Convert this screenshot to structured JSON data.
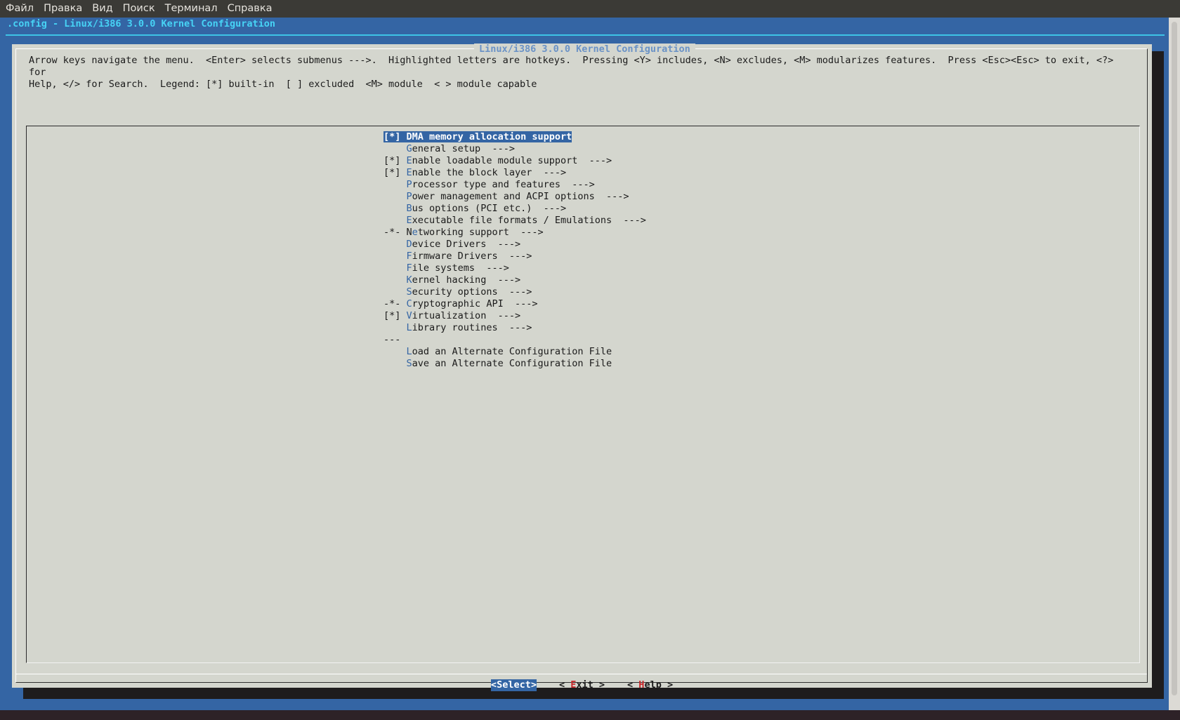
{
  "menubar": {
    "items": [
      "Файл",
      "Правка",
      "Вид",
      "Поиск",
      "Терминал",
      "Справка"
    ]
  },
  "terminal": {
    "title": ".config - Linux/i386 3.0.0 Kernel Configuration"
  },
  "dialog": {
    "title": "Linux/i386 3.0.0 Kernel Configuration",
    "help_text": "Arrow keys navigate the menu.  <Enter> selects submenus --->.  Highlighted letters are hotkeys.  Pressing <Y> includes, <N> excludes, <M> modularizes features.  Press <Esc><Esc> to exit, <?> for\nHelp, </> for Search.  Legend: [*] built-in  [ ] excluded  <M> module  < > module capable"
  },
  "menu": {
    "items": [
      {
        "prefix": "[*] ",
        "hotkey": "D",
        "rest": "MA memory allocation support",
        "selected": true
      },
      {
        "prefix": "    ",
        "hotkey": "G",
        "rest": "eneral setup  --->"
      },
      {
        "prefix": "[*] ",
        "hotkey": "E",
        "rest": "nable loadable module support  --->"
      },
      {
        "prefix": "[*] ",
        "hotkey": "E",
        "rest": "nable the block layer  --->"
      },
      {
        "prefix": "    ",
        "hotkey": "P",
        "rest": "rocessor type and features  --->"
      },
      {
        "prefix": "    ",
        "hotkey": "P",
        "rest": "ower management and ACPI options  --->"
      },
      {
        "prefix": "    ",
        "hotkey": "B",
        "rest": "us options (PCI etc.)  --->"
      },
      {
        "prefix": "    ",
        "hotkey": "E",
        "rest": "xecutable file formats / Emulations  --->"
      },
      {
        "prefix": "-*- N",
        "hotkey": "e",
        "rest": "tworking support  --->"
      },
      {
        "prefix": "    ",
        "hotkey": "D",
        "rest": "evice Drivers  --->"
      },
      {
        "prefix": "    ",
        "hotkey": "F",
        "rest": "irmware Drivers  --->"
      },
      {
        "prefix": "    ",
        "hotkey": "F",
        "rest": "ile systems  --->"
      },
      {
        "prefix": "    ",
        "hotkey": "K",
        "rest": "ernel hacking  --->"
      },
      {
        "prefix": "    ",
        "hotkey": "S",
        "rest": "ecurity options  --->"
      },
      {
        "prefix": "-*- ",
        "hotkey": "C",
        "rest": "ryptographic API  --->"
      },
      {
        "prefix": "[*] ",
        "hotkey": "V",
        "rest": "irtualization  --->"
      },
      {
        "prefix": "    ",
        "hotkey": "L",
        "rest": "ibrary routines  --->"
      },
      {
        "prefix": "---",
        "hotkey": "",
        "rest": ""
      },
      {
        "prefix": "    ",
        "hotkey": "L",
        "rest": "oad an Alternate Configuration File"
      },
      {
        "prefix": "    ",
        "hotkey": "S",
        "rest": "ave an Alternate Configuration File"
      }
    ]
  },
  "buttons": {
    "select": {
      "open": "<",
      "hotkey": "S",
      "rest": "elect>"
    },
    "exit": {
      "open": "< ",
      "hotkey": "E",
      "rest": "xit >"
    },
    "help": {
      "open": "< ",
      "hotkey": "H",
      "rest": "elp >"
    }
  }
}
